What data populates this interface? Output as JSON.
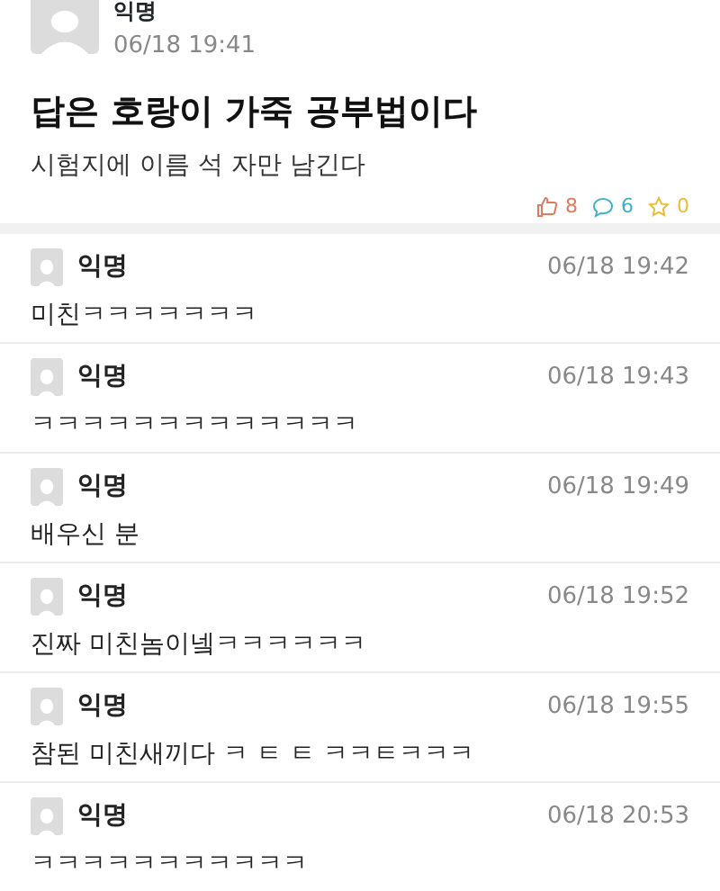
{
  "post": {
    "author": "익명",
    "time": "06/18 19:41",
    "title": "답은 호랑이 가죽 공부법이다",
    "body": "시험지에 이름 석 자만 남긴다",
    "stats": [
      {
        "kind": "like",
        "count": "8",
        "color": "#e07a5f"
      },
      {
        "kind": "comment",
        "count": "6",
        "color": "#3fb0c8"
      },
      {
        "kind": "scrap",
        "count": "0",
        "color": "#e8be3a"
      }
    ]
  },
  "comments": [
    {
      "author": "익명",
      "time": "06/18 19:42",
      "text": "미친ㅋㅋㅋㅋㅋㅋㅋ"
    },
    {
      "author": "익명",
      "time": "06/18 19:43",
      "text": "ㅋㅋㅋㅋㅋㅋㅋㅋㅋㅋㅋㅋㅋ"
    },
    {
      "author": "익명",
      "time": "06/18 19:49",
      "text": "배우신 분"
    },
    {
      "author": "익명",
      "time": "06/18 19:52",
      "text": "진짜 미친놈이넼ㅋㅋㅋㅋㅋㅋ"
    },
    {
      "author": "익명",
      "time": "06/18 19:55",
      "text": "참된 미친새끼다 ㅋ ㅌ ㅌ ㅋㅋㅌㅋㅋㅋ"
    },
    {
      "author": "익명",
      "time": "06/18 20:53",
      "text": "ㅋㅋㅋㅋㅋㅋㅋㅋㅋㅋㅋ"
    }
  ]
}
